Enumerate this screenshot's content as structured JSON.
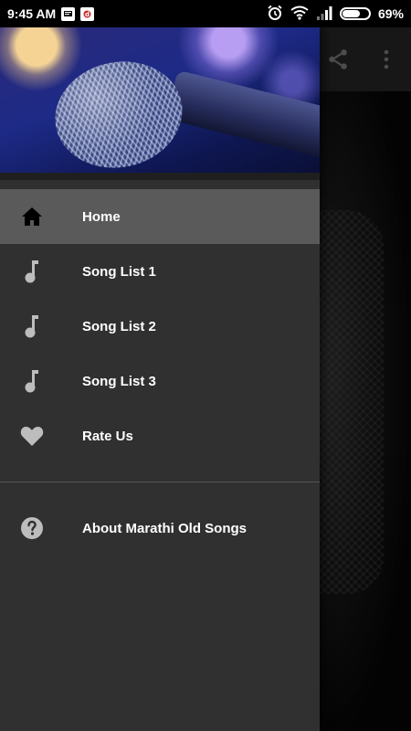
{
  "status_bar": {
    "time": "9:45 AM",
    "battery": "69%",
    "battery_level": 0.69
  },
  "drawer": {
    "items": [
      {
        "label": "Home",
        "icon": "home-icon",
        "active": true
      },
      {
        "label": "Song List 1",
        "icon": "music-note-icon",
        "active": false
      },
      {
        "label": "Song List 2",
        "icon": "music-note-icon",
        "active": false
      },
      {
        "label": "Song List 3",
        "icon": "music-note-icon",
        "active": false
      },
      {
        "label": "Rate Us",
        "icon": "heart-icon",
        "active": false
      }
    ],
    "secondary_items": [
      {
        "label": "About Marathi Old Songs",
        "icon": "help-circle-icon"
      }
    ]
  },
  "toolbar": {
    "share_icon": "share-icon",
    "overflow_icon": "more-vert-icon"
  },
  "colors": {
    "drawer_bg": "#303030",
    "active_item_bg": "#5a5a5a",
    "icon_gray": "#bdbdbd"
  }
}
